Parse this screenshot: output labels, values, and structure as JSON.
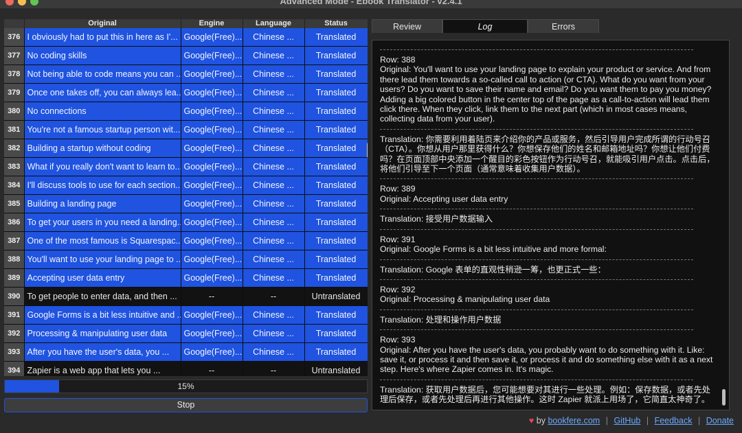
{
  "window": {
    "title": "Advanced Mode - Ebook Translator - v2.4.1"
  },
  "table": {
    "columns": [
      "Original",
      "Engine",
      "Language",
      "Status"
    ],
    "rows": [
      {
        "num": "376",
        "original": "I obviously had to put this in here as I'...",
        "engine": "Google(Free)...",
        "language": "Chinese ...",
        "status": "Translated",
        "state": "translated"
      },
      {
        "num": "377",
        "original": "No coding skills",
        "engine": "Google(Free)...",
        "language": "Chinese ...",
        "status": "Translated",
        "state": "translated"
      },
      {
        "num": "378",
        "original": "Not being able to code means you can ...",
        "engine": "Google(Free)...",
        "language": "Chinese ...",
        "status": "Translated",
        "state": "translated"
      },
      {
        "num": "379",
        "original": "Once one takes off, you can always lea...",
        "engine": "Google(Free)...",
        "language": "Chinese ...",
        "status": "Translated",
        "state": "translated"
      },
      {
        "num": "380",
        "original": "No connections",
        "engine": "Google(Free)...",
        "language": "Chinese ...",
        "status": "Translated",
        "state": "translated"
      },
      {
        "num": "381",
        "original": "You're not a famous startup person wit...",
        "engine": "Google(Free)...",
        "language": "Chinese ...",
        "status": "Translated",
        "state": "translated"
      },
      {
        "num": "382",
        "original": "Building a startup without coding",
        "engine": "Google(Free)...",
        "language": "Chinese ...",
        "status": "Translated",
        "state": "translated"
      },
      {
        "num": "383",
        "original": "What if you really don't want to learn to...",
        "engine": "Google(Free)...",
        "language": "Chinese ...",
        "status": "Translated",
        "state": "translated"
      },
      {
        "num": "384",
        "original": "I'll discuss tools to use for each section...",
        "engine": "Google(Free)...",
        "language": "Chinese ...",
        "status": "Translated",
        "state": "translated"
      },
      {
        "num": "385",
        "original": "Building a landing page",
        "engine": "Google(Free)...",
        "language": "Chinese ...",
        "status": "Translated",
        "state": "translated"
      },
      {
        "num": "386",
        "original": "To get your users in you need a landing...",
        "engine": "Google(Free)...",
        "language": "Chinese ...",
        "status": "Translated",
        "state": "translated"
      },
      {
        "num": "387",
        "original": "One of the most famous is Squarespac...",
        "engine": "Google(Free)...",
        "language": "Chinese ...",
        "status": "Translated",
        "state": "translated"
      },
      {
        "num": "388",
        "original": "You'll want to use your landing page to ...",
        "engine": "Google(Free)...",
        "language": "Chinese ...",
        "status": "Translated",
        "state": "translated"
      },
      {
        "num": "389",
        "original": "Accepting user data entry",
        "engine": "Google(Free)...",
        "language": "Chinese ...",
        "status": "Translated",
        "state": "translated"
      },
      {
        "num": "390",
        "original": "To get people to enter data, and then ...",
        "engine": "--",
        "language": "--",
        "status": "Untranslated",
        "state": "untranslated"
      },
      {
        "num": "391",
        "original": "Google Forms is a bit less intuitive and ...",
        "engine": "Google(Free)...",
        "language": "Chinese ...",
        "status": "Translated",
        "state": "translated"
      },
      {
        "num": "392",
        "original": "Processing & manipulating user data",
        "engine": "Google(Free)...",
        "language": "Chinese ...",
        "status": "Translated",
        "state": "translated"
      },
      {
        "num": "393",
        "original": "After you have the user's data, you ...",
        "engine": "Google(Free)...",
        "language": "Chinese ...",
        "status": "Translated",
        "state": "translated"
      },
      {
        "num": "394",
        "original": "Zapier is a web app that lets you ...",
        "engine": "--",
        "language": "--",
        "status": "Untranslated",
        "state": "untranslated"
      }
    ]
  },
  "progress": {
    "label": "15%",
    "value": 0.15
  },
  "stop_button": {
    "label": "Stop"
  },
  "tabs": [
    {
      "label": "Review",
      "active": false
    },
    {
      "label": "Log",
      "active": true
    },
    {
      "label": "Errors",
      "active": false
    }
  ],
  "log": {
    "entries": [
      {
        "row": "Row: 388",
        "original": "Original: You'll want to use your landing page to explain your product or service. And from there lead them towards a so-called call to action (or CTA). What do you want from your users? Do you want to save their name and email? Do you want them to pay you money? Adding a big colored button in the center top of the page as a call-to-action will lead them click there. When they click, link them to the next part (which in most cases means, collecting data from your user).",
        "translation": "Translation: 你需要利用着陆页来介绍你的产品或服务，然后引导用户完成所谓的行动号召（CTA）。你想从用户那里获得什么？你想保存他们的姓名和邮箱地址吗？你想让他们付费吗？在页面顶部中央添加一个醒目的彩色按钮作为行动号召，就能吸引用户点击。点击后，将他们引导至下一个页面（通常意味着收集用户数据）。"
      },
      {
        "row": "Row: 389",
        "original": "Original: Accepting user data entry",
        "translation": "Translation: 接受用户数据输入"
      },
      {
        "row": "Row: 391",
        "original": "Original: Google Forms is a bit less intuitive and more formal:",
        "translation": "Translation: Google 表单的直观性稍逊一筹，也更正式一些："
      },
      {
        "row": "Row: 392",
        "original": "Original: Processing & manipulating user data",
        "translation": "Translation: 处理和操作用户数据"
      },
      {
        "row": "Row: 393",
        "original": "Original: After you have the user's data, you probably want to do something with it. Like: save it, or process it and then save it, or process it and do something else with it as a next step. Here's where Zapier comes in. It's magic.",
        "translation": "Translation: 获取用户数据后，您可能想要对其进行一些处理。例如：保存数据，或者先处理后保存，或者先处理后再进行其他操作。这时 Zapier 就派上用场了，它简直太神奇了。"
      }
    ]
  },
  "footer": {
    "by": "by",
    "site": "bookfere.com",
    "github": "GitHub",
    "feedback": "Feedback",
    "donate": "Donate"
  },
  "colors": {
    "accent": "#1f53e0",
    "heart": "#e5475a",
    "link": "#6aa8ff"
  }
}
